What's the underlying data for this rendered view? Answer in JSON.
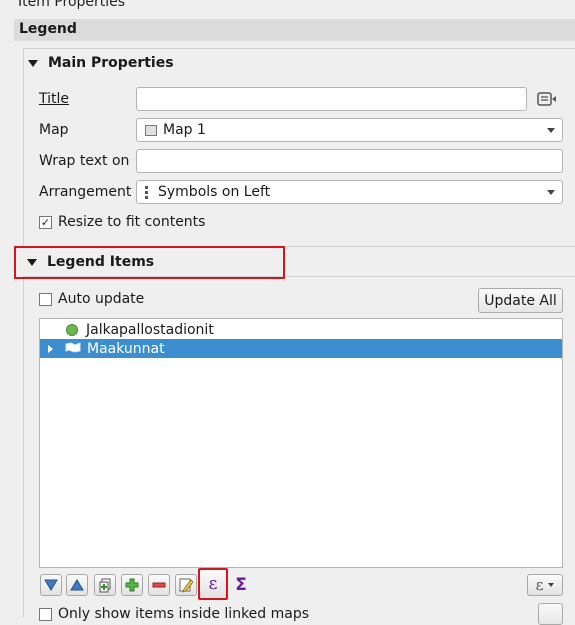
{
  "panel": {
    "title": "Item Properties"
  },
  "section": {
    "title": "Legend"
  },
  "main_properties": {
    "header": "Main Properties",
    "title_label": "Title",
    "title_value": "",
    "map_label": "Map",
    "map_value": "Map 1",
    "wrap_label": "Wrap text on",
    "wrap_value": "",
    "arrangement_label": "Arrangement",
    "arrangement_value": "Symbols on Left",
    "resize_label": "Resize to fit contents",
    "resize_checked": true
  },
  "legend_items": {
    "header": "Legend Items",
    "auto_update_label": "Auto update",
    "auto_update_checked": false,
    "update_all_label": "Update All",
    "items": [
      {
        "label": "Jalkapallostadionit",
        "symbol": "circle",
        "color": "#6fb64f",
        "selected": false
      },
      {
        "label": "Maakunnat",
        "symbol": "polygon",
        "selected": true
      }
    ],
    "toolbar": {
      "icons": [
        "move-down-icon",
        "move-up-icon",
        "add-group-icon",
        "add-item-icon",
        "remove-item-icon",
        "edit-item-icon",
        "expression-icon",
        "sum-icon"
      ]
    },
    "only_show_label": "Only show items inside linked maps",
    "only_show_checked": false
  },
  "colors": {
    "selection": "#3b8ed0",
    "highlight_border": "#d6141c",
    "expression": "#6a1b9a"
  }
}
